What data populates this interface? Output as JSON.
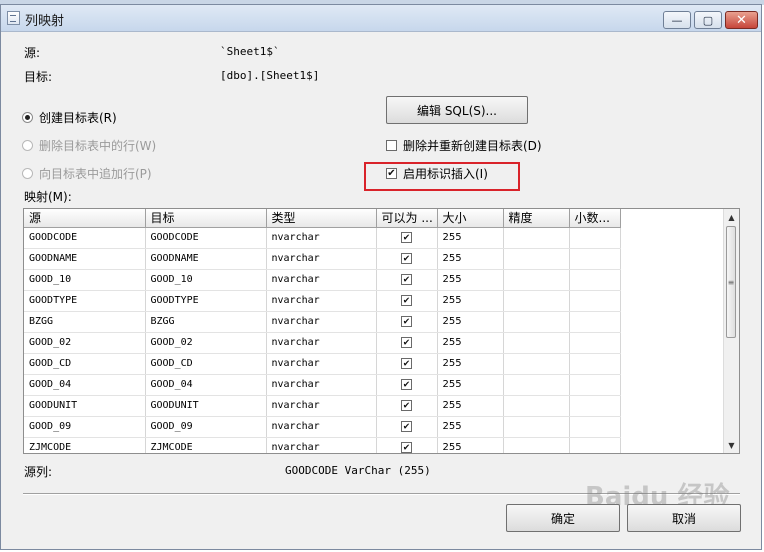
{
  "window": {
    "title": "列映射",
    "min": "—",
    "max": "▢",
    "close": "✕"
  },
  "source": {
    "label": "源:",
    "value": "`Sheet1$`"
  },
  "target": {
    "label": "目标:",
    "value": "[dbo].[Sheet1$]"
  },
  "options": {
    "create_table": "创建目标表(R)",
    "delete_rows": "删除目标表中的行(W)",
    "append_rows": "向目标表中追加行(P)",
    "edit_sql": "编辑 SQL(S)...",
    "drop_recreate": "删除并重新创建目标表(D)",
    "enable_identity": "启用标识插入(I)"
  },
  "mapping": {
    "label": "映射(M):",
    "columns": [
      "源",
      "目标",
      "类型",
      "可以为 ...",
      "大小",
      "精度",
      "小数..."
    ],
    "rows": [
      {
        "src": "GOODCODE",
        "dst": "GOODCODE",
        "type": "nvarchar",
        "nullable": "✔",
        "size": "255"
      },
      {
        "src": "GOODNAME",
        "dst": "GOODNAME",
        "type": "nvarchar",
        "nullable": "✔",
        "size": "255"
      },
      {
        "src": "GOOD_10",
        "dst": "GOOD_10",
        "type": "nvarchar",
        "nullable": "✔",
        "size": "255"
      },
      {
        "src": "GOODTYPE",
        "dst": "GOODTYPE",
        "type": "nvarchar",
        "nullable": "✔",
        "size": "255"
      },
      {
        "src": "BZGG",
        "dst": "BZGG",
        "type": "nvarchar",
        "nullable": "✔",
        "size": "255"
      },
      {
        "src": "GOOD_02",
        "dst": "GOOD_02",
        "type": "nvarchar",
        "nullable": "✔",
        "size": "255"
      },
      {
        "src": "GOOD_CD",
        "dst": "GOOD_CD",
        "type": "nvarchar",
        "nullable": "✔",
        "size": "255"
      },
      {
        "src": "GOOD_04",
        "dst": "GOOD_04",
        "type": "nvarchar",
        "nullable": "✔",
        "size": "255"
      },
      {
        "src": "GOODUNIT",
        "dst": "GOODUNIT",
        "type": "nvarchar",
        "nullable": "✔",
        "size": "255"
      },
      {
        "src": "GOOD_09",
        "dst": "GOOD_09",
        "type": "nvarchar",
        "nullable": "✔",
        "size": "255"
      },
      {
        "src": "ZJMCODE",
        "dst": "ZJMCODE",
        "type": "nvarchar",
        "nullable": "✔",
        "size": "255"
      }
    ]
  },
  "source_column": {
    "label": "源列:",
    "value": "GOODCODE VarChar (255)"
  },
  "buttons": {
    "ok": "确定",
    "cancel": "取消"
  },
  "watermark": "Baidu 经验"
}
